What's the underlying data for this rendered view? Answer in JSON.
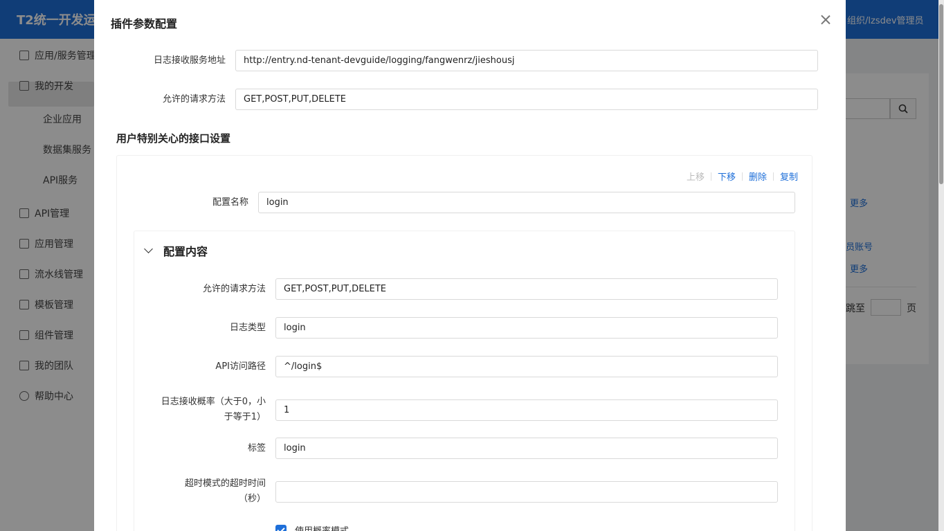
{
  "background": {
    "app_title": "T2统一开发运",
    "user_info": "组织/lzsdev管理员",
    "sidebar": [
      {
        "label": "应用/服务管理",
        "icon": "grid-icon"
      },
      {
        "label": "我的开发",
        "icon": "code-icon"
      },
      {
        "label": "企业应用",
        "icon": ""
      },
      {
        "label": "数据集服务",
        "icon": ""
      },
      {
        "label": "API服务",
        "icon": ""
      },
      {
        "label": "API管理",
        "icon": "link-icon"
      },
      {
        "label": "应用管理",
        "icon": "apps-icon"
      },
      {
        "label": "流水线管理",
        "icon": "pipeline-icon"
      },
      {
        "label": "模板管理",
        "icon": "template-icon"
      },
      {
        "label": "组件管理",
        "icon": "component-icon"
      },
      {
        "label": "我的团队",
        "icon": "team-icon"
      },
      {
        "label": "帮助中心",
        "icon": "help-icon"
      }
    ],
    "more_1": "更多",
    "account_link": "员账号",
    "more_2": "更多",
    "jump_to": "跳至",
    "page_unit": "页"
  },
  "modal": {
    "title": "插件参数配置",
    "fields": {
      "log_service_url": {
        "label": "日志接收服务地址",
        "value": "http://entry.nd-tenant-devguide/logging/fangwenrz/jieshousj"
      },
      "allowed_methods": {
        "label": "允许的请求方法",
        "value": "GET,POST,PUT,DELETE"
      }
    },
    "section_title": "用户特别关心的接口设置",
    "ops": {
      "up": "上移",
      "down": "下移",
      "delete": "删除",
      "copy": "复制"
    },
    "config_name": {
      "label": "配置名称",
      "value": "login"
    },
    "collapse_title": "配置内容",
    "content_fields": {
      "methods": {
        "label": "允许的请求方法",
        "value": "GET,POST,PUT,DELETE"
      },
      "log_type": {
        "label": "日志类型",
        "value": "login"
      },
      "api_path": {
        "label": "API访问路径",
        "value": "^/login$"
      },
      "probability": {
        "label": "日志接收概率（大于0，小于等于1）",
        "value": "1"
      },
      "tag": {
        "label": "标签",
        "value": "login"
      },
      "timeout": {
        "label": "超时模式的超时时间（秒）",
        "value": ""
      }
    },
    "checkbox": {
      "label": "使用概率模式",
      "checked": true
    }
  }
}
